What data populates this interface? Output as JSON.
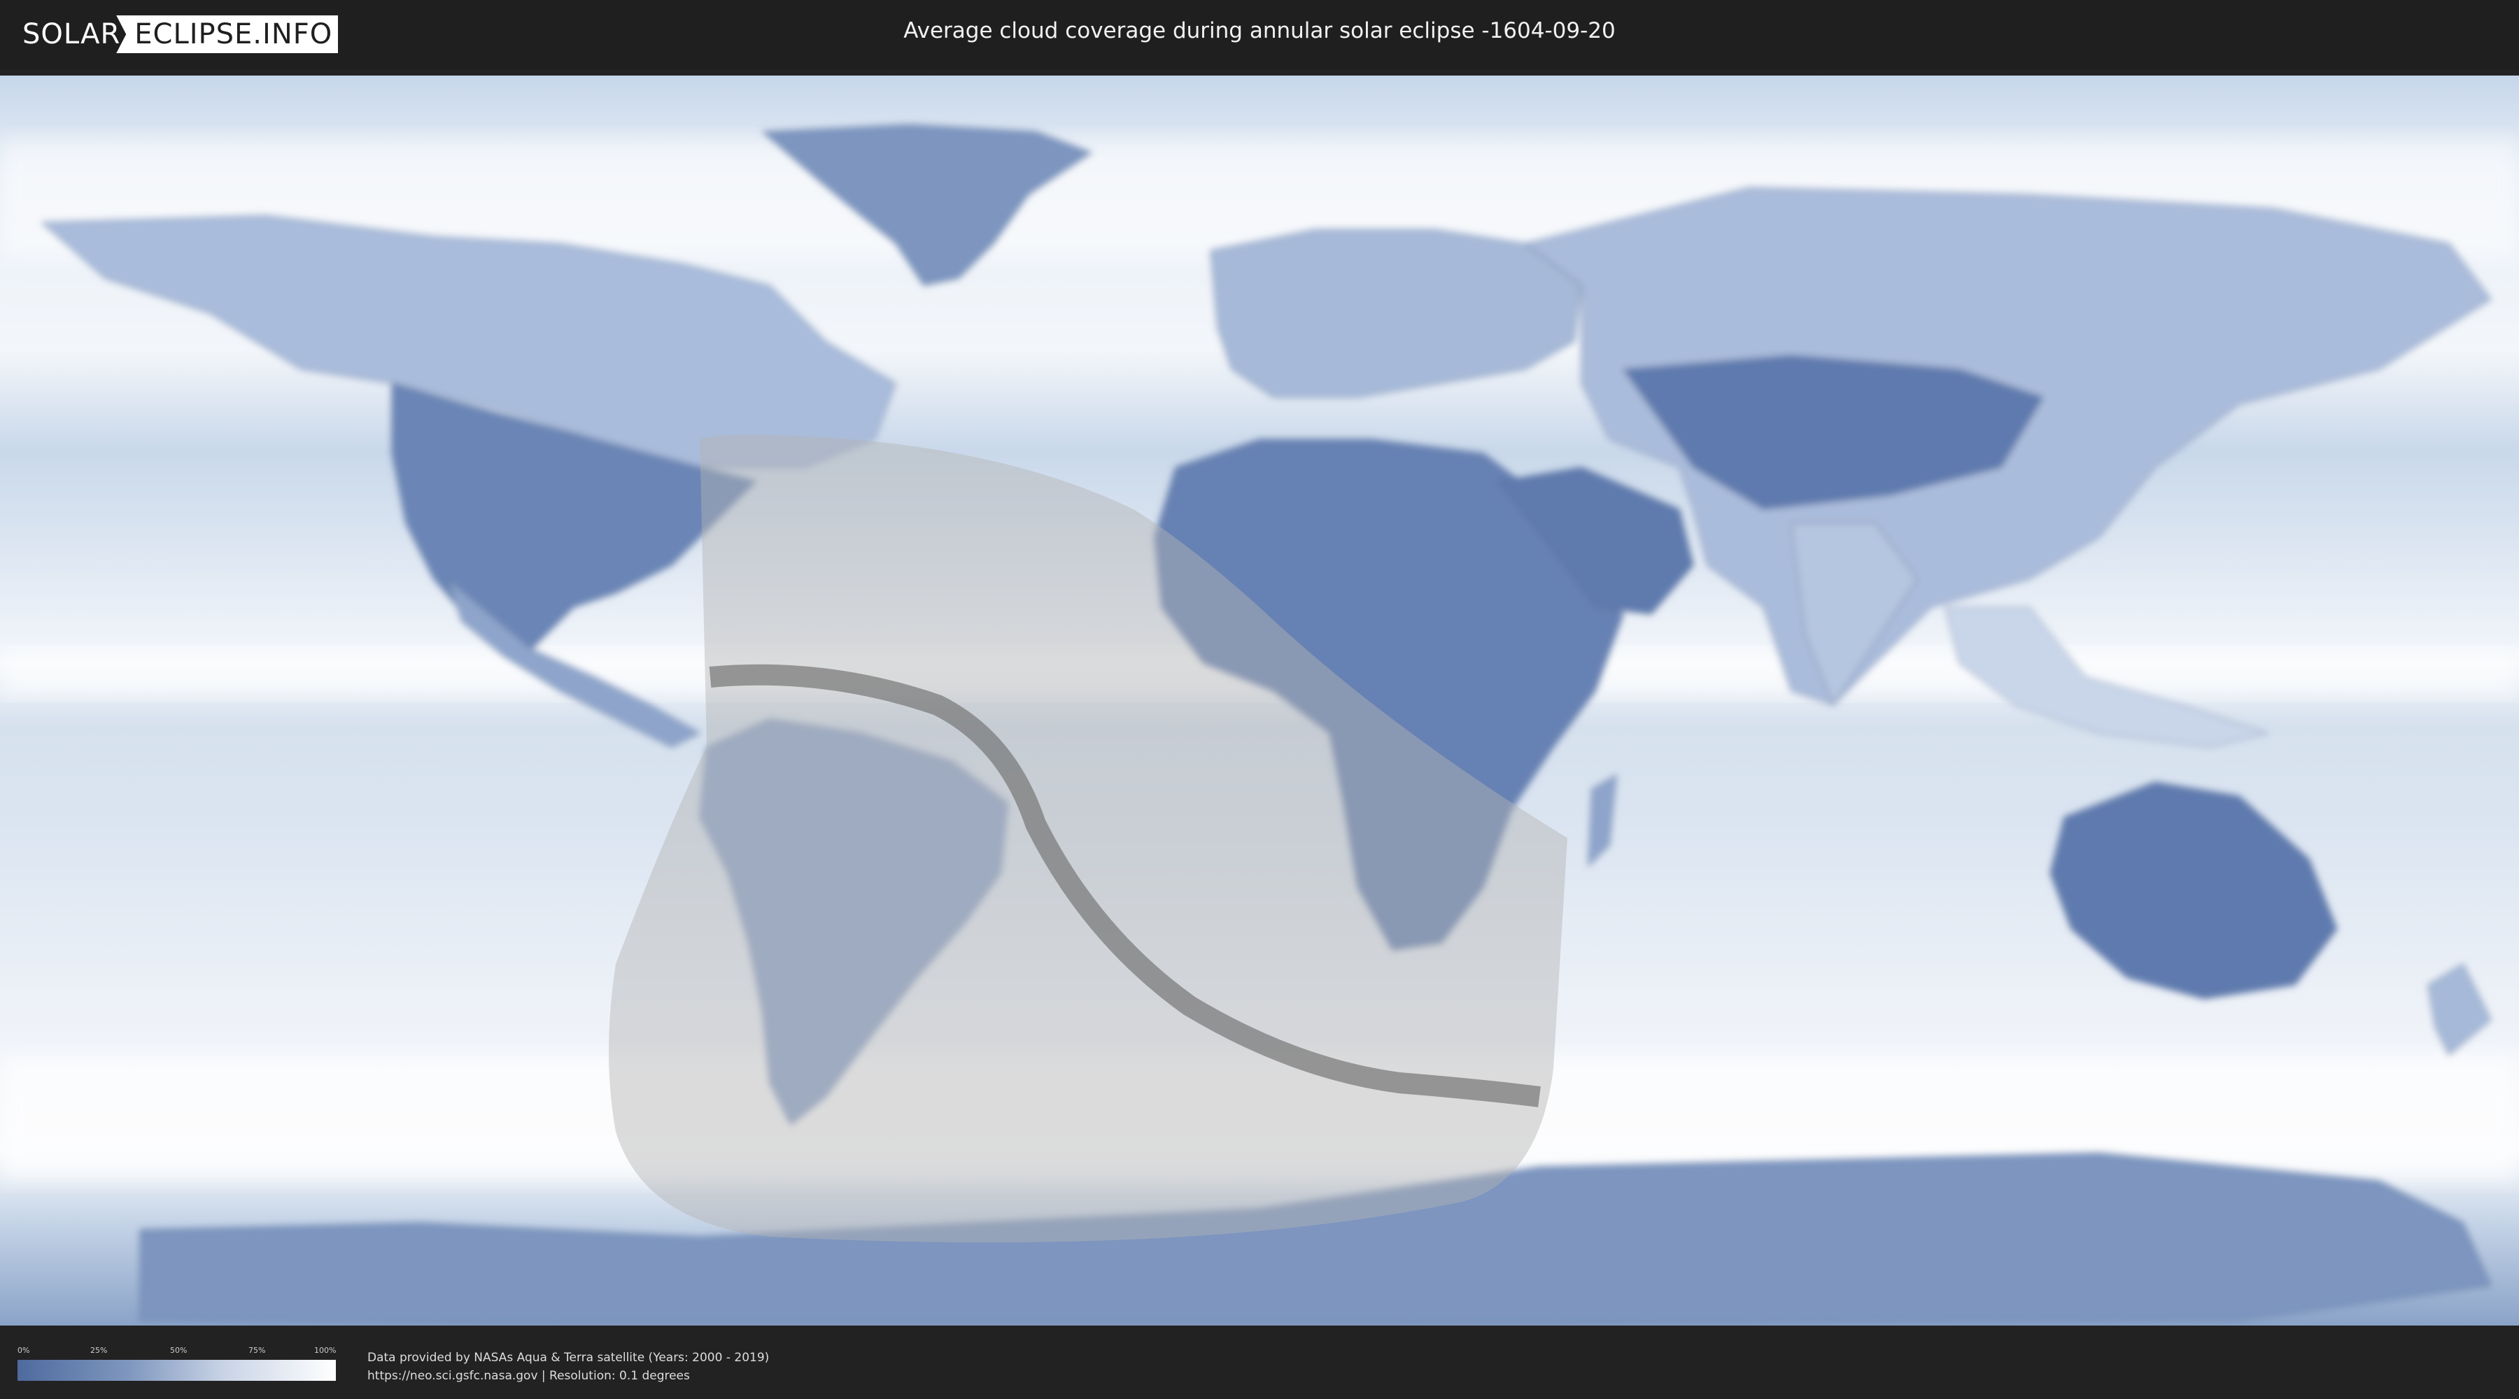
{
  "header": {
    "logo_left": "SOLAR",
    "logo_right": "ECLIPSE.INFO",
    "title": "Average cloud coverage during annular solar eclipse -1604-09-20"
  },
  "legend": {
    "ticks": [
      "0%",
      "25%",
      "50%",
      "75%",
      "100%"
    ],
    "colors": [
      "#4e6a9e",
      "#ffffff"
    ]
  },
  "footer": {
    "credit_line1": "Data provided by NASAs Aqua & Terra satellite (Years: 2000 - 2019)",
    "credit_line2": "https://neo.sci.gsfc.nasa.gov | Resolution: 0.1 degrees"
  },
  "map": {
    "type": "equirectangular world map, cloud coverage",
    "colors": {
      "clear_land": "#5d79ad",
      "cloudy": "#ffffff",
      "ocean_base": "#dfe8f3",
      "penumbra": "#b4b4b4",
      "path": "#6e6e6e"
    }
  }
}
